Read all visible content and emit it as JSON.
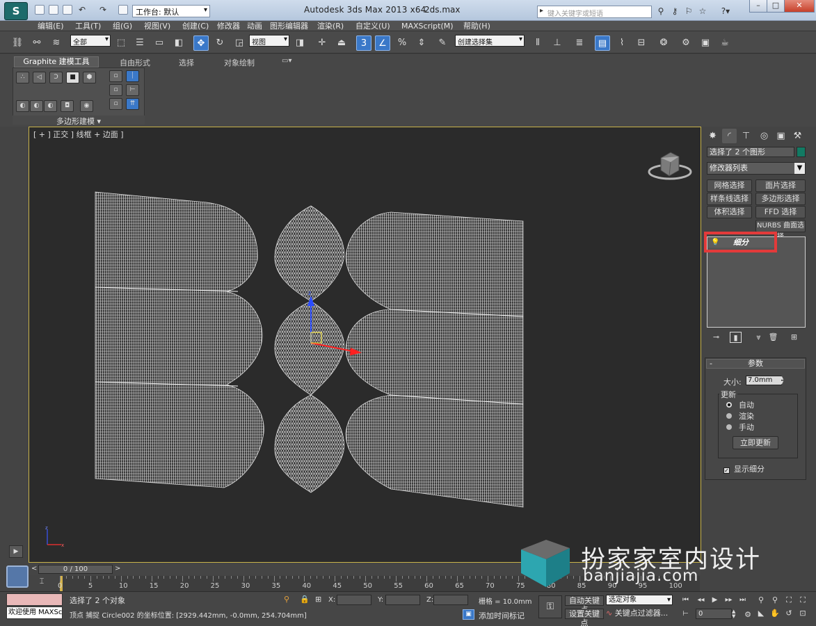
{
  "title_bar": {
    "workspace_label": "工作台: 默认",
    "window_title": "Autodesk 3ds Max  2013 x64",
    "file_name": "2ds.max",
    "search_placeholder": "键入关键字或短语"
  },
  "menu": [
    "编辑(E)",
    "工具(T)",
    "组(G)",
    "视图(V)",
    "创建(C)",
    "修改器",
    "动画",
    "图形编辑器",
    "渲染(R)",
    "自定义(U)",
    "MAXScript(M)",
    "帮助(H)"
  ],
  "toolbar": {
    "filter_value": "全部",
    "ref_coord_value": "视图",
    "named_sel_value": "创建选择集",
    "snap_value": "3"
  },
  "ribbon": {
    "tabs": [
      "Graphite 建模工具",
      "自由形式",
      "选择",
      "对象绘制"
    ],
    "panel_label": "多边形建模 ▾"
  },
  "viewport": {
    "label": "[ + ] 正交 ] 线框 + 边面 ]"
  },
  "command_panel": {
    "object_name": "选择了 2 个图形",
    "object_color": "#127a63",
    "modifier_list": "修改器列表",
    "modifier_buttons": [
      "网格选择",
      "面片选择",
      "样条线选择",
      "多边形选择",
      "体积选择",
      "FFD 选择",
      "NURBS 曲面选择"
    ],
    "stack_item": "细分",
    "params_title": "参数",
    "size_label": "大小:",
    "size_value": "7.0mm",
    "update_label": "更新",
    "update_options": [
      "自动",
      "渲染",
      "手动"
    ],
    "update_selected": "自动",
    "update_now": "立即更新",
    "show_subdivision": "显示细分",
    "show_subdivision_checked": true
  },
  "timeline": {
    "slider_text": "0 / 100",
    "ticks": [
      "0",
      "5",
      "10",
      "15",
      "20",
      "25",
      "30",
      "35",
      "40",
      "45",
      "50",
      "55",
      "60",
      "65",
      "70",
      "75",
      "80",
      "85",
      "90",
      "95",
      "100"
    ]
  },
  "status": {
    "listener_text": "欢迎使用 MAXSc",
    "line1": "选择了 2 个对象",
    "line2": "顶点 捕捉 Circle002 的坐标位置: [2929.442mm, -0.0mm, 254.704mm]",
    "x_label": "X:",
    "y_label": "Y:",
    "z_label": "Z:",
    "grid": "栅格 = 10.0mm",
    "add_time_tag": "添加时间标记",
    "auto_key": "自动关键点",
    "set_key": "设置关键点",
    "selection_filter": "选定对象",
    "key_filters": "关键点过滤器...",
    "frame_value": "0"
  },
  "watermark": {
    "cn": "扮家家室内设计",
    "en": "banjiajia.com"
  }
}
